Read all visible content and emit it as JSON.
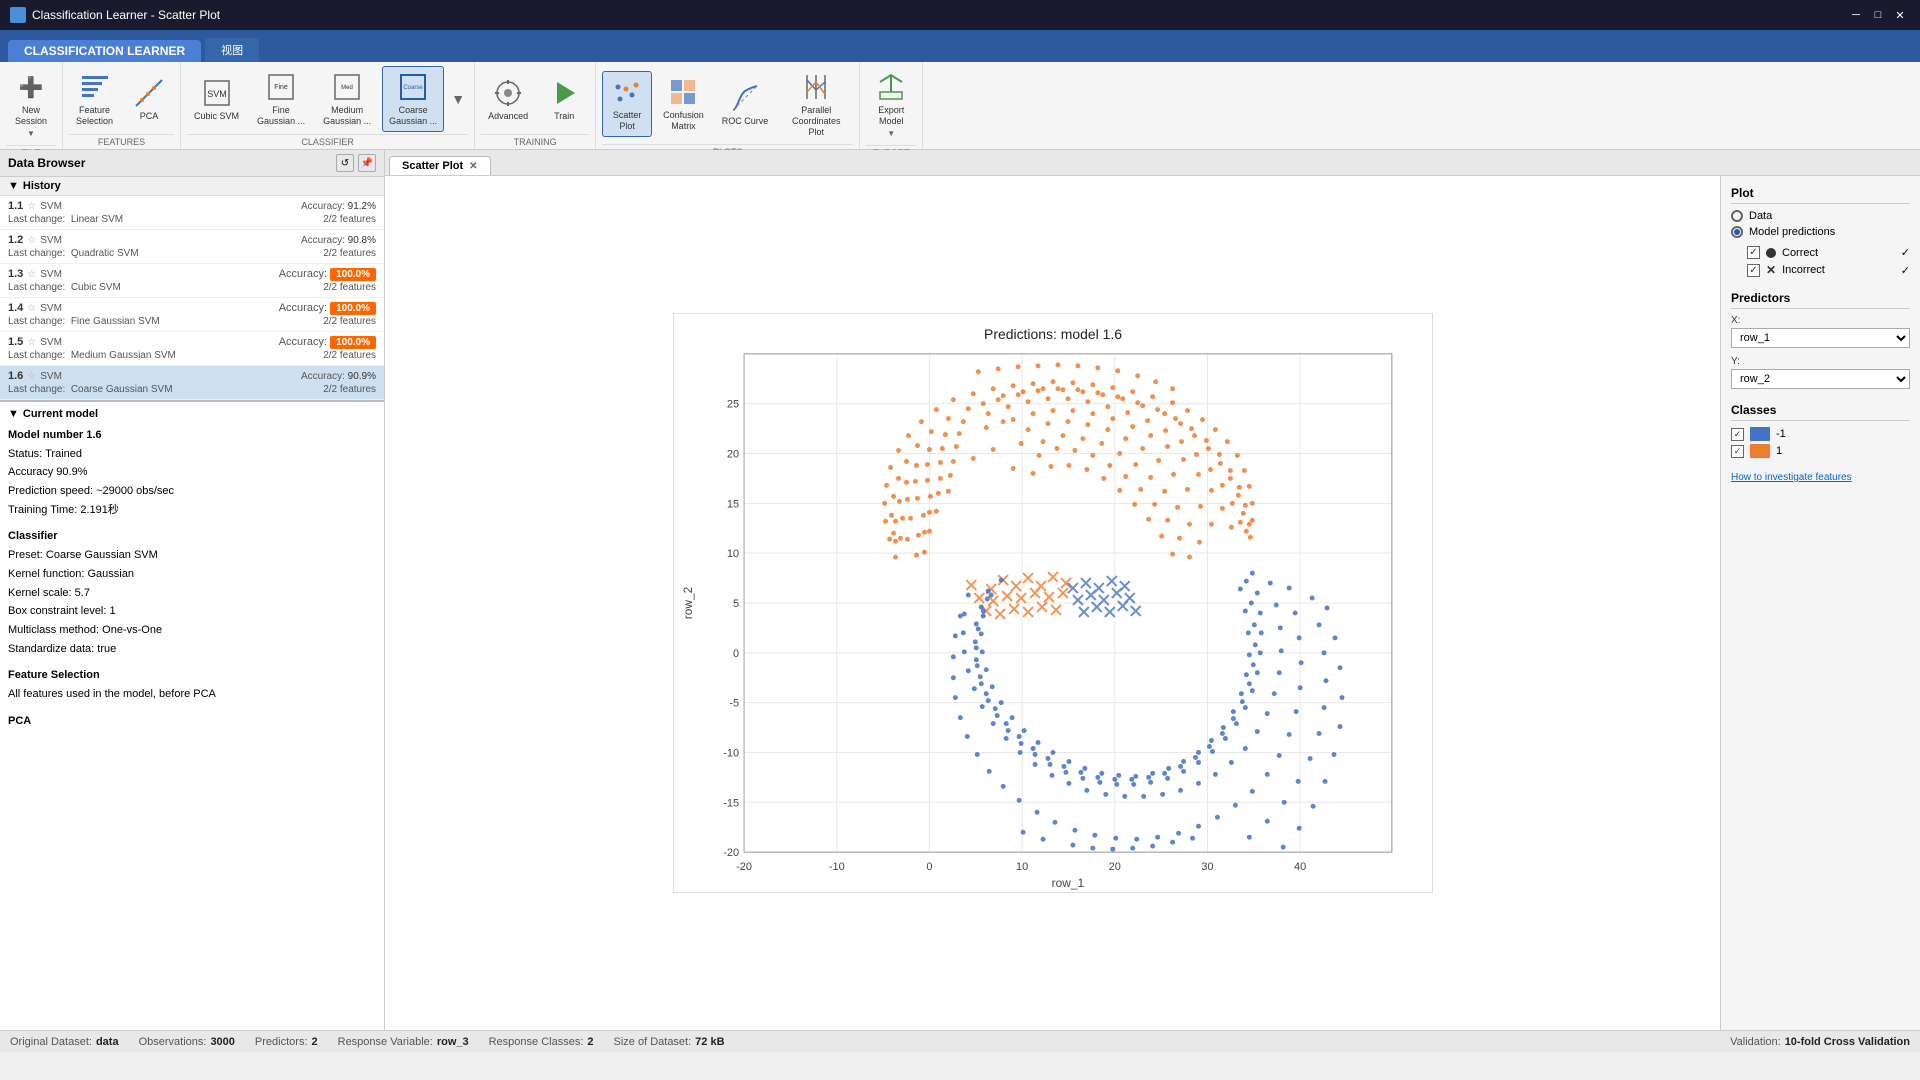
{
  "window": {
    "title": "Classification Learner - Scatter Plot",
    "icon": "🔵"
  },
  "appTabs": [
    {
      "label": "CLASSIFICATION LEARNER",
      "active": true
    },
    {
      "label": "视图",
      "active": false
    }
  ],
  "ribbon": {
    "sections": [
      {
        "name": "FILE",
        "label": "FILE",
        "tools": [
          {
            "id": "new-session",
            "icon": "➕",
            "label": "New\nSession",
            "dropdown": true
          }
        ]
      },
      {
        "name": "FEATURES",
        "label": "FEATURES",
        "tools": [
          {
            "id": "feature-selection",
            "icon": "📊",
            "label": "Feature\nSelection"
          },
          {
            "id": "pca",
            "icon": "📈",
            "label": "PCA"
          }
        ]
      },
      {
        "name": "CLASSIFIER",
        "label": "CLASSIFIER",
        "tools": [
          {
            "id": "cubic-svm",
            "icon": "⬜",
            "label": "Cubic SVM"
          },
          {
            "id": "fine-gaussian",
            "icon": "⬜",
            "label": "Fine\nGaussian ..."
          },
          {
            "id": "medium-gaussian",
            "icon": "⬜",
            "label": "Medium\nGaussian ..."
          },
          {
            "id": "coarse-gaussian",
            "icon": "⬜",
            "label": "Coarse\nGaussian ...",
            "active": true
          },
          {
            "id": "expand",
            "icon": "▼",
            "label": ""
          }
        ]
      },
      {
        "name": "TRAINING",
        "label": "TRAINING",
        "tools": [
          {
            "id": "advanced",
            "icon": "⚙",
            "label": "Advanced"
          },
          {
            "id": "train",
            "icon": "▶",
            "label": "Train"
          }
        ]
      },
      {
        "name": "PLOTS",
        "label": "PLOTS",
        "tools": [
          {
            "id": "scatter-plot",
            "icon": "🔵",
            "label": "Scatter\nPlot",
            "active": true
          },
          {
            "id": "confusion-matrix",
            "icon": "📋",
            "label": "Confusion\nMatrix"
          },
          {
            "id": "roc-curve",
            "icon": "📉",
            "label": "ROC Curve"
          },
          {
            "id": "parallel-coords",
            "icon": "📊",
            "label": "Parallel\nCoordinates Plot"
          }
        ]
      },
      {
        "name": "EXPORT",
        "label": "EXPORT",
        "tools": [
          {
            "id": "export-model",
            "icon": "✅",
            "label": "Export\nModel",
            "dropdown": true
          }
        ]
      }
    ]
  },
  "dataBrowser": {
    "title": "Data Browser",
    "history": {
      "label": "History",
      "items": [
        {
          "id": "1.1",
          "type": "SVM",
          "accuracyLabel": "Accuracy:",
          "accuracy": "91.2%",
          "accuracyHighlight": false,
          "lastChange": "Linear SVM",
          "features": "2/2 features"
        },
        {
          "id": "1.2",
          "type": "SVM",
          "accuracyLabel": "Accuracy:",
          "accuracy": "90.8%",
          "accuracyHighlight": false,
          "lastChange": "Quadratic SVM",
          "features": "2/2 features"
        },
        {
          "id": "1.3",
          "type": "SVM",
          "accuracyLabel": "Accuracy:",
          "accuracy": "100.0%",
          "accuracyHighlight": true,
          "lastChange": "Cubic SVM",
          "features": "2/2 features"
        },
        {
          "id": "1.4",
          "type": "SVM",
          "accuracyLabel": "Accuracy:",
          "accuracy": "100.0%",
          "accuracyHighlight": true,
          "lastChange": "Fine Gaussian SVM",
          "features": "2/2 features"
        },
        {
          "id": "1.5",
          "type": "SVM",
          "accuracyLabel": "Accuracy:",
          "accuracy": "100.0%",
          "accuracyHighlight": true,
          "lastChange": "Medium Gaussian SVM",
          "features": "2/2 features"
        },
        {
          "id": "1.6",
          "type": "SVM",
          "accuracyLabel": "Accuracy:",
          "accuracy": "90.9%",
          "accuracyHighlight": false,
          "lastChange": "Coarse Gaussian SVM",
          "features": "2/2 features",
          "selected": true
        }
      ]
    }
  },
  "currentModel": {
    "sectionLabel": "Current model",
    "modelNumber": "Model number 1.6",
    "status": "Trained",
    "accuracy": "90.9%",
    "predictionSpeed": "~29000 obs/sec",
    "trainingTime": "2.191秒",
    "classifierLabel": "Classifier",
    "preset": "Coarse Gaussian SVM",
    "kernelFunction": "Gaussian",
    "kernelScale": "5.7",
    "boxConstraint": "1",
    "multiclassMethod": "One-vs-One",
    "standardizeData": "true",
    "featureSelectionLabel": "Feature Selection",
    "featureSelectionDetail": "All features used in the model, before PCA",
    "pcaLabel": "PCA"
  },
  "plotTab": {
    "label": "Scatter Plot"
  },
  "plot": {
    "title": "Predictions: model 1.6",
    "xLabel": "row_1",
    "yLabel": "row_2",
    "xTickLabels": [
      "-20",
      "-10",
      "0",
      "10",
      "20",
      "30",
      "40"
    ],
    "yTickLabels": [
      "-20",
      "-15",
      "-10",
      "-5",
      "0",
      "5",
      "10",
      "15",
      "20",
      "25"
    ]
  },
  "rightPanel": {
    "plotLabel": "Plot",
    "radioOptions": [
      {
        "id": "data",
        "label": "Data",
        "selected": false
      },
      {
        "id": "model-predictions",
        "label": "Model predictions",
        "selected": true
      }
    ],
    "checkboxOptions": [
      {
        "id": "correct",
        "label": "Correct",
        "checked": true,
        "symbol": "dot"
      },
      {
        "id": "incorrect",
        "label": "Incorrect",
        "checked": true,
        "symbol": "x"
      }
    ],
    "predictorsLabel": "Predictors",
    "xPredictor": "row_1",
    "yPredictor": "row_2",
    "classesLabel": "Classes",
    "classes": [
      {
        "label": "-1",
        "color": "#4472C4",
        "checked": true
      },
      {
        "label": "1",
        "color": "#ED7D31",
        "checked": true
      }
    ],
    "helpLink": "How to investigate features"
  },
  "statusBar": {
    "originalDataset": "data",
    "observations": "3000",
    "predictors": "2",
    "responseVariable": "row_3",
    "responseClasses": "2",
    "sizeOfDataset": "72 kB",
    "validation": "10-fold Cross Validation"
  }
}
